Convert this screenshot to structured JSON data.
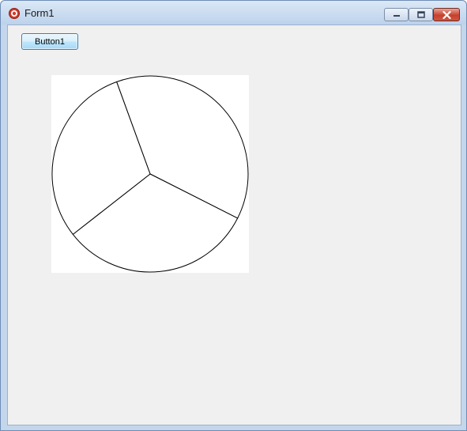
{
  "window": {
    "title": "Form1",
    "icon": "app-icon"
  },
  "caption_buttons": {
    "minimize_icon": "minimize-icon",
    "maximize_icon": "maximize-icon",
    "close_icon": "close-icon",
    "close_color": "#c6412f"
  },
  "form": {
    "button1_label": "Button1",
    "background": "#f0f0f0"
  },
  "chart_data": {
    "type": "pie",
    "values": [
      0.38,
      0.32,
      0.3
    ],
    "title": "",
    "fill": "#ffffff",
    "stroke": "#000000"
  }
}
